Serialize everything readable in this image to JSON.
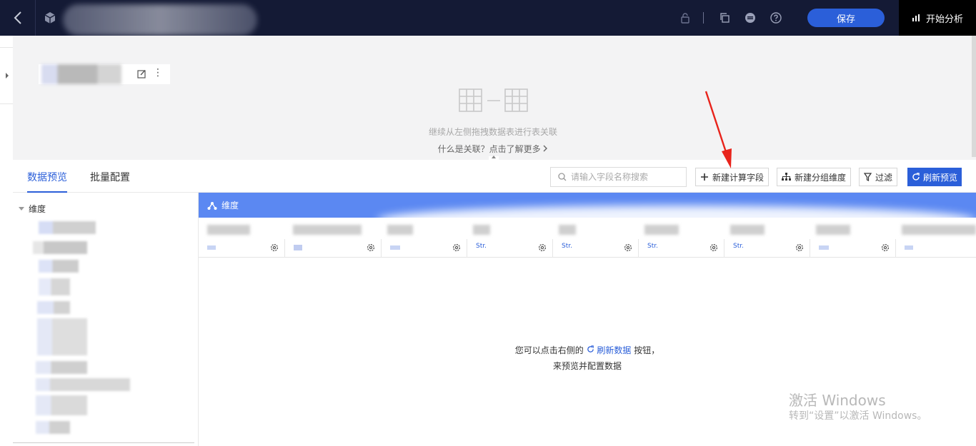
{
  "header": {
    "save_label": "保存",
    "start_analysis_label": "开始分析"
  },
  "canvas": {
    "join_hint": "继续从左侧拖拽数据表进行表关联",
    "join_link": "什么是关联？点击了解更多"
  },
  "tabs": [
    {
      "label": "数据预览",
      "active": true
    },
    {
      "label": "批量配置",
      "active": false
    }
  ],
  "toolbar": {
    "search_placeholder": "请输入字段名称搜索",
    "new_calc_field": "新建计算字段",
    "new_group_dim": "新建分组维度",
    "filter": "过滤",
    "refresh_preview": "刷新预览"
  },
  "tree": {
    "root_label": "维度"
  },
  "grid": {
    "dimension_label": "维度",
    "column_types": [
      "Str.",
      "Str.",
      "Str.",
      "Str."
    ],
    "empty_line1_prefix": "您可以点击右侧的",
    "empty_line1_link": "刷新数据",
    "empty_line1_suffix": "按钮，",
    "empty_line2": "来预览并配置数据"
  },
  "watermark": {
    "line1": "激活 Windows",
    "line2": "转到“设置”以激活 Windows。"
  },
  "colors": {
    "header_bg": "#141a35",
    "accent": "#2b5fd9",
    "dimension_bar": "#5b88f2",
    "annotation_arrow": "#e8231b"
  }
}
